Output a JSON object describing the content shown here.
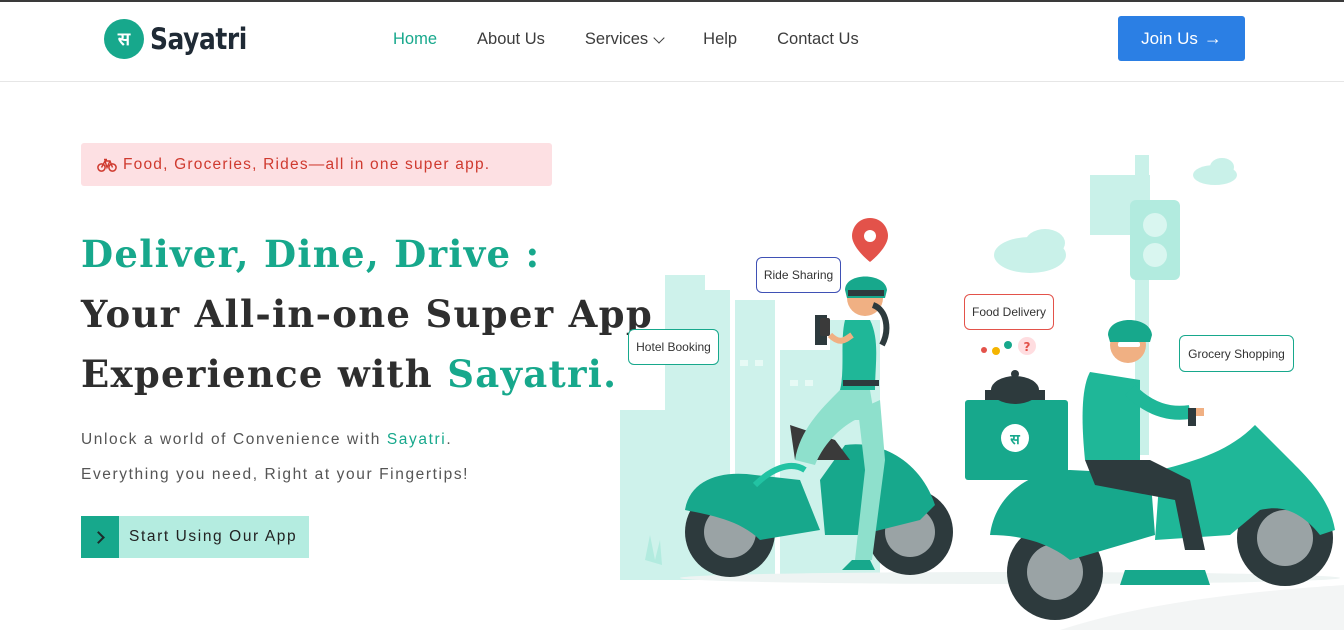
{
  "brand": {
    "name": "Sayatri",
    "logo_glyph": "स",
    "color": "#17a88c"
  },
  "nav": {
    "items": [
      {
        "label": "Home",
        "active": true
      },
      {
        "label": "About Us",
        "active": false
      },
      {
        "label": "Services",
        "active": false,
        "has_dropdown": true
      },
      {
        "label": "Help",
        "active": false
      },
      {
        "label": "Contact Us",
        "active": false
      }
    ]
  },
  "header": {
    "join_label": "Join Us",
    "join_arrow": "→",
    "join_color": "#2b7fe4"
  },
  "hero": {
    "tagline": "Food, Groceries, Rides—all in one super app.",
    "heading": {
      "line1": "Deliver, Dine, Drive :",
      "line2": "Your All-in-one Super App",
      "line3_prefix": "Experience with ",
      "line3_brand": "Sayatri."
    },
    "sub1_prefix": "Unlock a world of Convenience with ",
    "sub1_brand": "Sayatri",
    "sub1_suffix": ".",
    "sub2": "Everything you need, Right at your Fingertips!",
    "cta_label": "Start Using Our App"
  },
  "illustration": {
    "labels": {
      "ride_sharing": "Ride Sharing",
      "hotel_booking": "Hotel Booking",
      "food_delivery": "Food Delivery",
      "grocery_shopping": "Grocery Shopping"
    },
    "box_glyph": "स",
    "question_mark": "?"
  }
}
